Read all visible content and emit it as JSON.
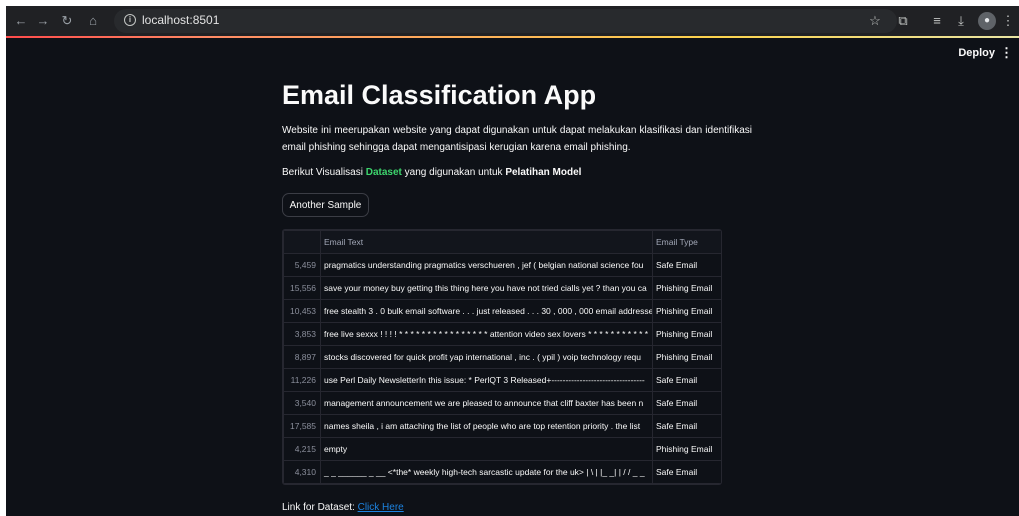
{
  "browser": {
    "url": "localhost:8501",
    "nav_icons": [
      "back-arrow-icon",
      "forward-arrow-icon",
      "reload-icon",
      "home-icon"
    ],
    "toolbar_icons": [
      "bookmark-star-icon",
      "extensions-icon",
      "reading-list-icon",
      "download-icon",
      "profile-icon",
      "menu-kebab-icon"
    ]
  },
  "header": {
    "deploy_label": "Deploy",
    "menu_glyph": "⋮"
  },
  "main": {
    "title": "Email Classification App",
    "description": "Website ini meerupakan website yang dapat digunakan untuk dapat melakukan klasifikasi dan identifikasi email phishing sehingga dapat mengantisipasi kerugian karena email phishing.",
    "viz_prefix": "Berikut Visualisasi ",
    "viz_dataset": "Dataset",
    "viz_middle": " yang digunakan untuk ",
    "viz_bold": "Pelatihan Model",
    "sample_button": "Another Sample",
    "link_prefix": "Link for Dataset: ",
    "link_text": "Click Here"
  },
  "table": {
    "columns": [
      "",
      "Email Text",
      "Email Type"
    ],
    "rows": [
      [
        "5,459",
        "pragmatics understanding pragmatics verschueren , jef ( belgian national science fou",
        "Safe Email"
      ],
      [
        "15,556",
        "save your money buy getting this thing here you have not tried cialls yet ? than you ca",
        "Phishing Email"
      ],
      [
        "10,453",
        "free stealth 3 . 0 bulk email software . . . just released . . . 30 , 000 , 000 email addresse",
        "Phishing Email"
      ],
      [
        "3,853",
        "free live sexxx ! ! ! ! * * * * * * * * * * * * * * * * attention video sex lovers * * * * * * * * * * *",
        "Phishing Email"
      ],
      [
        "8,897",
        "stocks discovered for quick profit yap international , inc . ( ypil ) voip technology requ",
        "Phishing Email"
      ],
      [
        "11,226",
        "use Perl Daily NewsletterIn this issue:    * PerlQT 3 Released+---------------------------------",
        "Safe Email"
      ],
      [
        "3,540",
        "management announcement we are pleased to announce that cliff baxter has been n",
        "Safe Email"
      ],
      [
        "17,585",
        "names sheila , i am attaching the list of people who are top retention priority . the list",
        "Safe Email"
      ],
      [
        "4,215",
        "empty",
        "Phishing Email"
      ],
      [
        "4,310",
        "_ _ ______ _ __ <*the* weekly high-tech sarcastic update for the uk> | \\ | |_ _| | / / _ _",
        "Safe Email"
      ]
    ]
  },
  "colors": {
    "page_bg": "#0e1117",
    "text": "#fafafa",
    "accent_green": "#3dd56d",
    "link_blue": "#1c83e1",
    "chrome_bg": "#202124"
  }
}
